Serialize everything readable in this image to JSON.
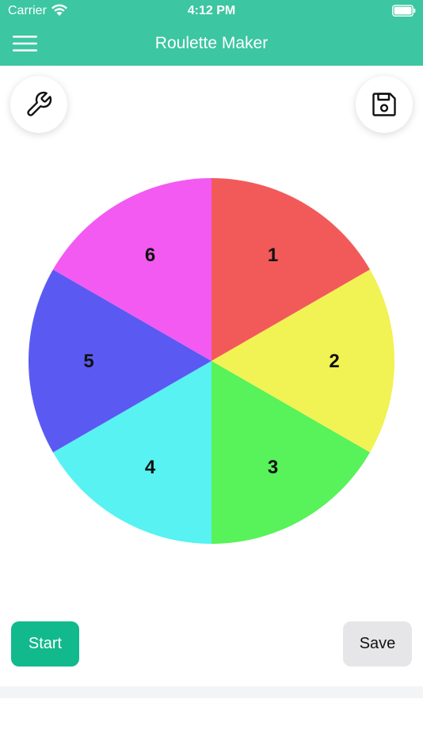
{
  "status_bar": {
    "carrier": "Carrier",
    "time": "4:12 PM",
    "icons": [
      "wifi-icon",
      "battery-icon"
    ]
  },
  "header": {
    "title": "Roulette Maker",
    "menu_icon": "hamburger-menu-icon",
    "background_color": "#3cc6a2"
  },
  "toolbar": {
    "settings_icon": "wrench-icon",
    "save_icon": "floppy-disk-icon"
  },
  "wheel": {
    "segments": [
      {
        "label": "1",
        "color": "#f25a5a"
      },
      {
        "label": "2",
        "color": "#f1f253"
      },
      {
        "label": "3",
        "color": "#58f25a"
      },
      {
        "label": "4",
        "color": "#58f2f2"
      },
      {
        "label": "5",
        "color": "#5a5af2"
      },
      {
        "label": "6",
        "color": "#f25af2"
      }
    ]
  },
  "actions": {
    "start_label": "Start",
    "save_label": "Save",
    "start_color": "#12b98c",
    "save_color": "#e6e6e8"
  }
}
